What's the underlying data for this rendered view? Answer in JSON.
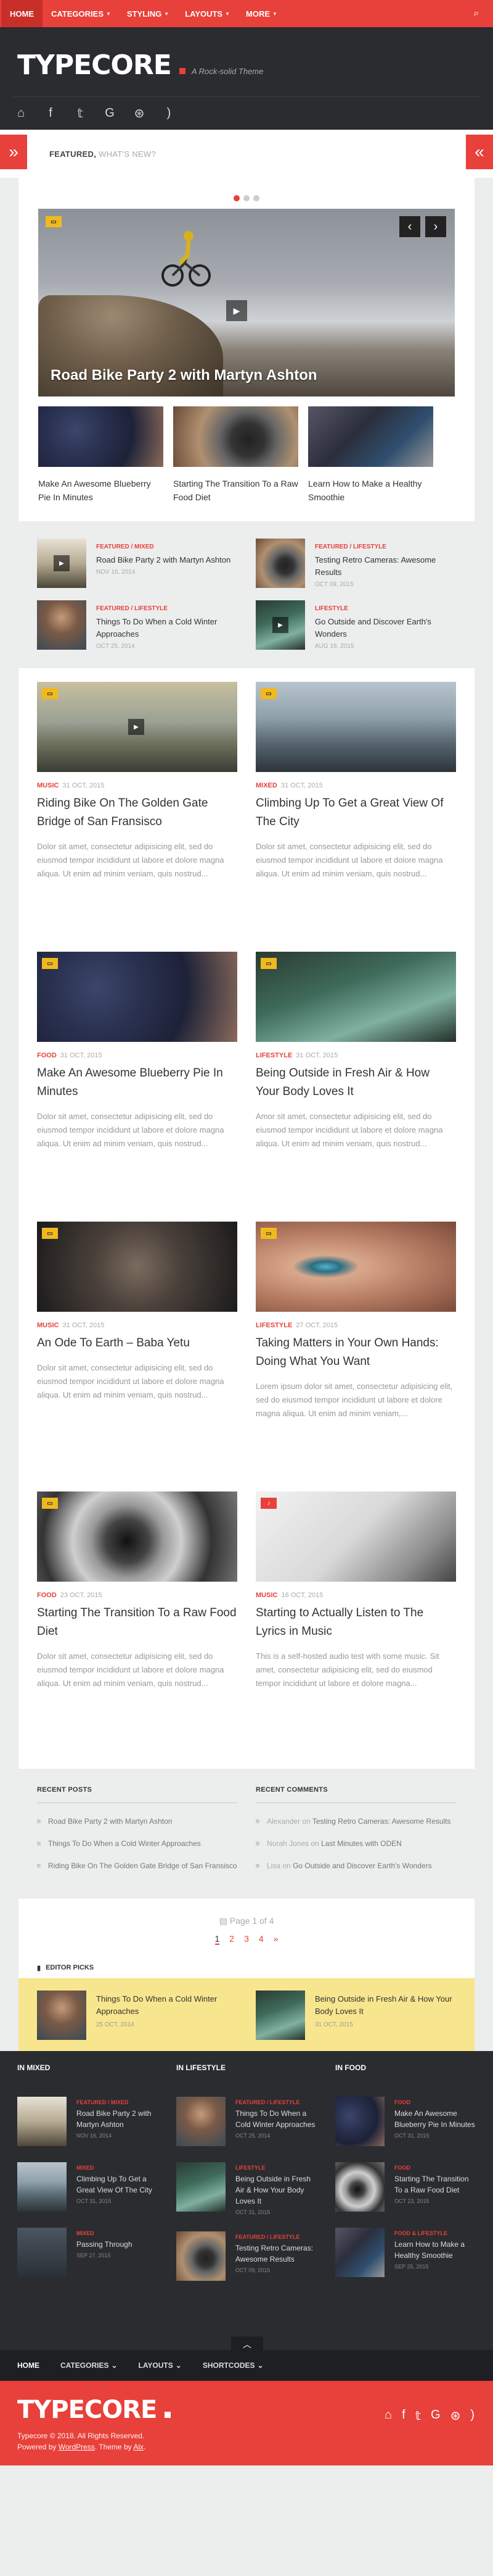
{
  "topnav": {
    "items": [
      {
        "label": "HOME"
      },
      {
        "label": "CATEGORIES"
      },
      {
        "label": "STYLING"
      },
      {
        "label": "LAYOUTS"
      },
      {
        "label": "MORE"
      }
    ]
  },
  "header": {
    "logo": "TYPECORE",
    "tagline": "A Rock-solid Theme"
  },
  "featured": {
    "label": "FEATURED,",
    "sub": "WHAT'S NEW?"
  },
  "slider": {
    "title": "Road Bike Party 2 with Martyn Ashton"
  },
  "thumbs": [
    {
      "caption": "Make An Awesome Blueberry Pie In Minutes"
    },
    {
      "caption": "Starting The Transition To a Raw Food Diet"
    },
    {
      "caption": "Learn How to Make a Healthy Smoothie"
    }
  ],
  "minilist": [
    {
      "cat": "FEATURED / MIXED",
      "title": "Road Bike Party 2 with Martyn Ashton",
      "date": "NOV 16, 2014"
    },
    {
      "cat": "FEATURED / LIFESTYLE",
      "title": "Testing Retro Cameras: Awesome Results",
      "date": "OCT 09, 2015"
    },
    {
      "cat": "FEATURED / LIFESTYLE",
      "title": "Things To Do When a Cold Winter Approaches",
      "date": "OCT 25, 2014"
    },
    {
      "cat": "LIFESTYLE",
      "title": "Go Outside and Discover Earth's Wonders",
      "date": "AUG 16, 2015"
    }
  ],
  "posts": [
    {
      "cat": "MUSIC",
      "date": "31 OCT, 2015",
      "title": "Riding Bike On The Golden Gate Bridge of San Fransisco",
      "excerpt": "Dolor sit amet, consectetur adipisicing elit, sed do eiusmod tempor incididunt ut labore et dolore magna aliqua. Ut enim ad minim veniam, quis nostrud..."
    },
    {
      "cat": "MIXED",
      "date": "31 OCT, 2015",
      "title": "Climbing Up To Get a Great View Of The City",
      "excerpt": "Dolor sit amet, consectetur adipisicing elit, sed do eiusmod tempor incididunt ut labore et dolore magna aliqua. Ut enim ad minim veniam, quis nostrud..."
    },
    {
      "cat": "FOOD",
      "date": "31 OCT, 2015",
      "title": "Make An Awesome Blueberry Pie In Minutes",
      "excerpt": "Dolor sit amet, consectetur adipisicing elit, sed do eiusmod tempor incididunt ut labore et dolore magna aliqua. Ut enim ad minim veniam, quis nostrud..."
    },
    {
      "cat": "LIFESTYLE",
      "date": "31 OCT, 2015",
      "title": "Being Outside in Fresh Air & How Your Body Loves It",
      "excerpt": "Amor sit amet, consectetur adipisicing elit, sed do eiusmod tempor incididunt ut labore et dolore magna aliqua. Ut enim ad minim veniam, quis nostrud..."
    },
    {
      "cat": "MUSIC",
      "date": "31 OCT, 2015",
      "title": "An Ode To Earth – Baba Yetu",
      "excerpt": "Dolor sit amet, consectetur adipisicing elit, sed do eiusmod tempor incididunt ut labore et dolore magna aliqua. Ut enim ad minim veniam, quis nostrud..."
    },
    {
      "cat": "LIFESTYLE",
      "date": "27 OCT, 2015",
      "title": "Taking Matters in Your Own Hands: Doing What You Want",
      "excerpt": "Lorem ipsum dolor sit amet, consectetur adipisicing elit, sed do eiusmod tempor incididunt ut labore et dolore magna aliqua. Ut enim ad minim veniam,..."
    },
    {
      "cat": "FOOD",
      "date": "23 OCT, 2015",
      "title": "Starting The Transition To a Raw Food Diet",
      "excerpt": "Dolor sit amet, consectetur adipisicing elit, sed do eiusmod tempor incididunt ut labore et dolore magna aliqua. Ut enim ad minim veniam, quis nostrud..."
    },
    {
      "cat": "MUSIC",
      "date": "16 OCT, 2015",
      "title": "Starting to Actually Listen to The Lyrics in Music",
      "excerpt": "This is a self-hosted audio test with some music. Sit amet, consectetur adipisicing elit, sed do eiusmod tempor incididunt ut labore et dolore magna..."
    }
  ],
  "widgets": {
    "recent_posts": {
      "title": "RECENT POSTS",
      "items": [
        "Road Bike Party 2 with Martyn Ashton",
        "Things To Do When a Cold Winter Approaches",
        "Riding Bike On The Golden Gate Bridge of San Fransisco"
      ]
    },
    "recent_comments": {
      "title": "RECENT COMMENTS",
      "items": [
        {
          "who": "Alexander",
          "on": "on",
          "post": "Testing Retro Cameras: Awesome Results"
        },
        {
          "who": "Norah Jones",
          "on": "on",
          "post": "Last Minutes with ODEN"
        },
        {
          "who": "Lisa",
          "on": "on",
          "post": "Go Outside and Discover Earth's Wonders"
        }
      ]
    }
  },
  "pager": {
    "label": "Page 1 of 4",
    "pages": [
      "1",
      "2",
      "3",
      "4",
      "»"
    ]
  },
  "picks": {
    "title": "EDITOR PICKS",
    "items": [
      {
        "title": "Things To Do When a Cold Winter Approaches",
        "date": "25 OCT, 2014"
      },
      {
        "title": "Being Outside in Fresh Air & How Your Body Loves It",
        "date": "31 OCT, 2015"
      }
    ]
  },
  "footer": {
    "cols": [
      {
        "title": "IN MIXED",
        "items": [
          {
            "cat": "FEATURED / MIXED",
            "title": "Road Bike Party 2 with Martyn Ashton",
            "date": "NOV 16, 2014"
          },
          {
            "cat": "MIXED",
            "title": "Climbing Up To Get a Great View Of The City",
            "date": "OCT 31, 2015"
          },
          {
            "cat": "MIXED",
            "title": "Passing Through",
            "date": "SEP 27, 2015"
          }
        ]
      },
      {
        "title": "IN LIFESTYLE",
        "items": [
          {
            "cat": "FEATURED / LIFESTYLE",
            "title": "Things To Do When a Cold Winter Approaches",
            "date": "OCT 25, 2014"
          },
          {
            "cat": "LIFESTYLE",
            "title": "Being Outside in Fresh Air & How Your Body Loves It",
            "date": "OCT 31, 2015"
          },
          {
            "cat": "FEATURED / LIFESTYLE",
            "title": "Testing Retro Cameras: Awesome Results",
            "date": "OCT 09, 2015"
          }
        ]
      },
      {
        "title": "IN FOOD",
        "items": [
          {
            "cat": "FOOD",
            "title": "Make An Awesome Blueberry Pie In Minutes",
            "date": "OCT 31, 2015"
          },
          {
            "cat": "FOOD",
            "title": "Starting The Transition To a Raw Food Diet",
            "date": "OCT 23, 2015"
          },
          {
            "cat": "FOOD & LIFESTYLE",
            "title": "Learn How to Make a Healthy Smoothie",
            "date": "SEP 25, 2015"
          }
        ]
      }
    ]
  },
  "botnav": {
    "items": [
      {
        "label": "HOME"
      },
      {
        "label": "CATEGORIES"
      },
      {
        "label": "LAYOUTS"
      },
      {
        "label": "SHORTCODES"
      }
    ]
  },
  "bottom": {
    "logo": "TYPECORE",
    "copy1": "Typecore © 2018. All Rights Reserved.",
    "copy2a": "Powered by",
    "copy2b": "WordPress",
    "copy2c": ". Theme by",
    "copy2d": "Alx",
    "copy2e": "."
  },
  "colors": {
    "accent": "#e8403a",
    "dark": "#2a2c30",
    "picks_band": "#f8e68e"
  }
}
